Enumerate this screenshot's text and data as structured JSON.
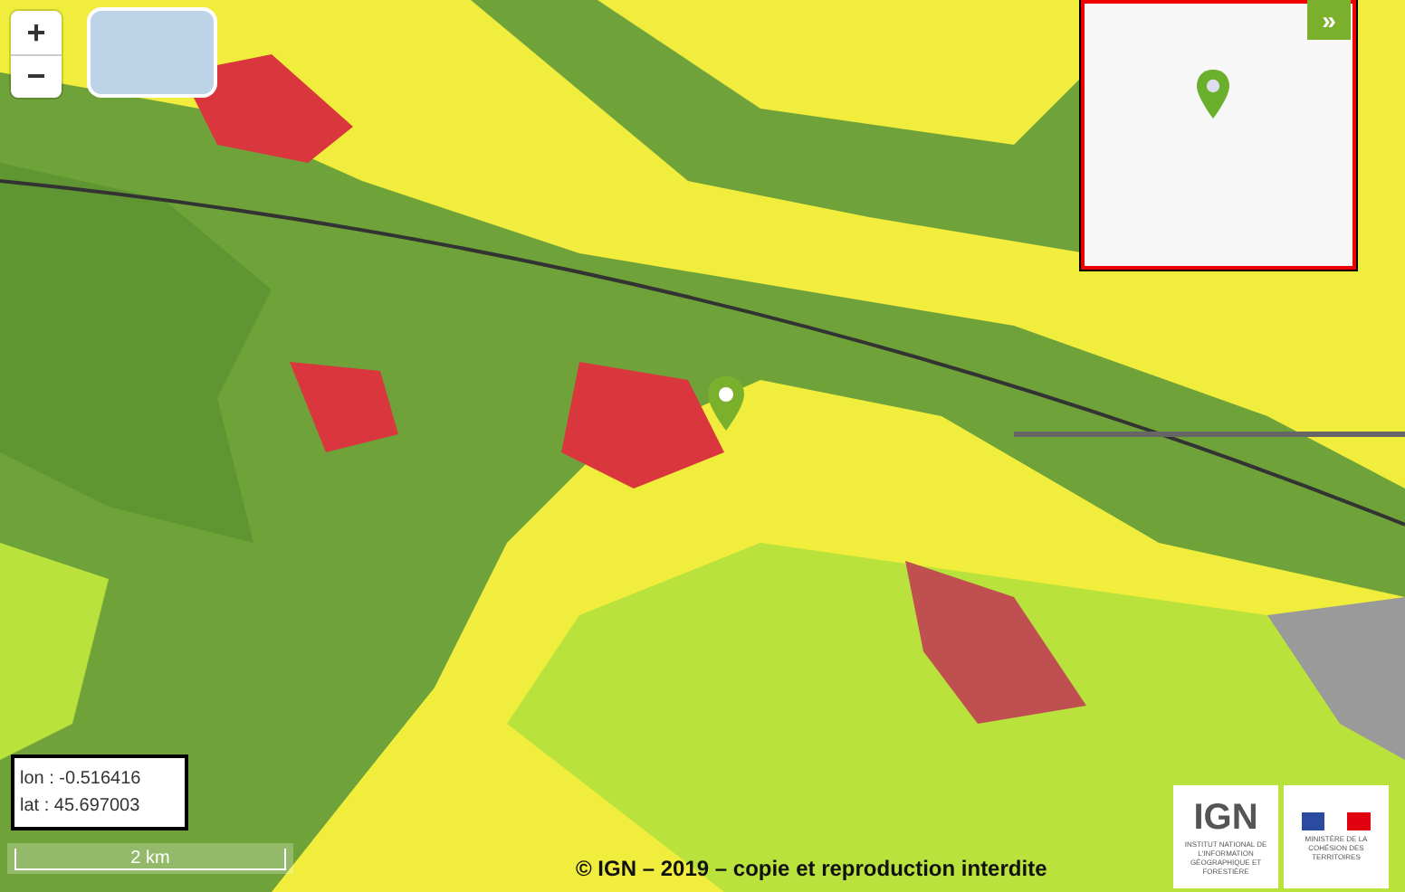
{
  "zoom_controls": [
    {
      "label": "+"
    },
    {
      "label": "−"
    }
  ],
  "overview": {
    "toggle": "»"
  },
  "coordinates": {
    "lon": "lon : -0.516416",
    "lat": "lat : 45.697003"
  },
  "scale": {
    "label": "2 km"
  },
  "attribution": "© IGN – 2019 – copie et reproduction interdite",
  "logos": {
    "ign": {
      "name": "IGN",
      "subtitle": "INSTITUT NATIONAL DE L'INFORMATION GÉOGRAPHIQUE ET FORESTIÈRE"
    },
    "ministry": "MINISTÈRE DE LA COHÉSION DES TERRITOIRES"
  }
}
